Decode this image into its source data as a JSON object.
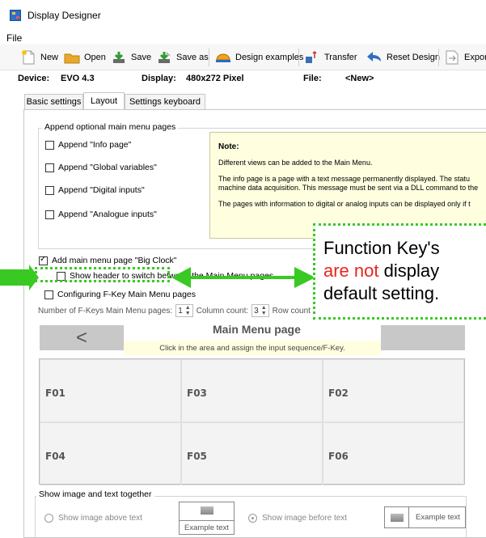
{
  "window": {
    "title": "Display Designer"
  },
  "menu": {
    "file": "File"
  },
  "toolbar": {
    "new": "New",
    "open": "Open",
    "save": "Save",
    "save_as": "Save as",
    "design_examples": "Design examples",
    "transfer": "Transfer",
    "reset_design": "Reset Design",
    "export": "Export"
  },
  "device_bar": {
    "device_label": "Device:",
    "device_value": "EVO 4.3",
    "display_label": "Display:",
    "display_value": "480x272 Pixel",
    "file_label": "File:",
    "file_value": "<New>"
  },
  "tabs": [
    "Basic settings",
    "Layout",
    "Settings keyboard"
  ],
  "append_group": {
    "title": "Append optional main menu pages",
    "items": [
      "Append \"Info page\"",
      "Append \"Global variables\"",
      "Append \"Digital inputs\"",
      "Append \"Analogue inputs\""
    ]
  },
  "note": {
    "title": "Note:",
    "lines": [
      "Different views can be added to the Main Menu.",
      "The info page is a page with a text message permanently displayed. The statu",
      "machine data acquisition. This message must be sent via a DLL command to the",
      "The pages with information to digital or analog inputs can be displayed only if t"
    ]
  },
  "big_clock": {
    "label": "Add main menu page \"Big Clock\"",
    "checked": true,
    "show_header": "Show header to switch between the Main Menu pages",
    "configure_fkeys": "Configuring F-Key Main Menu pages"
  },
  "fkey_settings": {
    "pages_label": "Number of F-Keys Main Menu pages:",
    "pages_value": "1",
    "columns_label": "Column count:",
    "columns_value": "3",
    "rows_label": "Row count"
  },
  "preview": {
    "prev": "<",
    "title": "Main Menu page",
    "hint": "Click in the area and assign the input sequence/F-Key.",
    "cells": [
      "F01",
      "F03",
      "F02",
      "F04",
      "F05",
      "F06"
    ]
  },
  "image_text": {
    "title": "Show image and text together",
    "option_above": "Show image above text",
    "option_before": "Show image before text",
    "example": "Example text",
    "selected": "before"
  },
  "callout": {
    "line1": "Function Key's",
    "line2_red": "are not",
    "line2_rest": " display",
    "line3": "default setting.",
    "color_border": "#39c922",
    "color_red": "#e8261d"
  }
}
